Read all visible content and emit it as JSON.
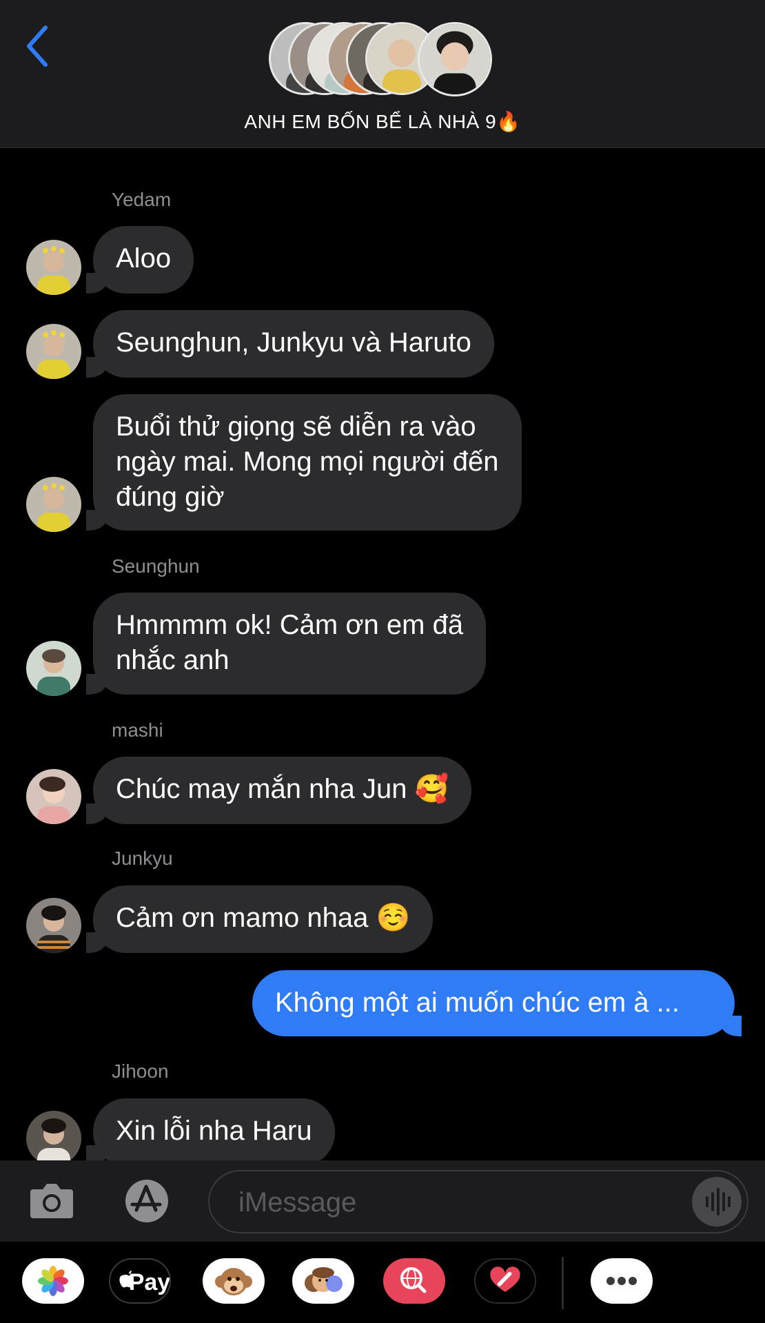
{
  "header": {
    "title": "ANH EM BỐN BỂ LÀ NHÀ 9",
    "title_emoji": "🔥"
  },
  "messages": [
    {
      "sender": "Yedam",
      "text": "Aloo"
    },
    {
      "sender": "Yedam",
      "text": "Seunghun, Junkyu và Haruto"
    },
    {
      "sender": "Yedam",
      "lines": [
        "Buổi thử giọng sẽ diễn ra vào",
        "ngày mai. Mong mọi người đến",
        "đúng giờ"
      ]
    },
    {
      "sender": "Seunghun",
      "lines": [
        "Hmmmm ok! Cảm ơn em đã",
        "nhắc anh"
      ]
    },
    {
      "sender": "mashi",
      "text": "Chúc may mắn nha Jun",
      "emoji": "🥰"
    },
    {
      "sender": "Junkyu",
      "text": "Cảm ơn mamo nhaa",
      "emoji": "☺️"
    },
    {
      "sender": "me",
      "text": "Không một ai muốn chúc em à ..."
    },
    {
      "sender": "Jihoon",
      "text": "Xin lỗi nha Haru"
    }
  ],
  "composer": {
    "placeholder": "iMessage"
  },
  "app_strip": {
    "apple_pay_label": "Pay",
    "icons": [
      "photos-icon",
      "apple-pay-icon",
      "monkey-animoji-icon",
      "memoji-icon",
      "web-search-icon",
      "digital-touch-icon",
      "more-icon"
    ]
  },
  "colors": {
    "accent_blue": "#2f7cf6",
    "bubble_gray": "#2c2c2e",
    "background": "#000000",
    "bar": "#1c1c1e"
  }
}
